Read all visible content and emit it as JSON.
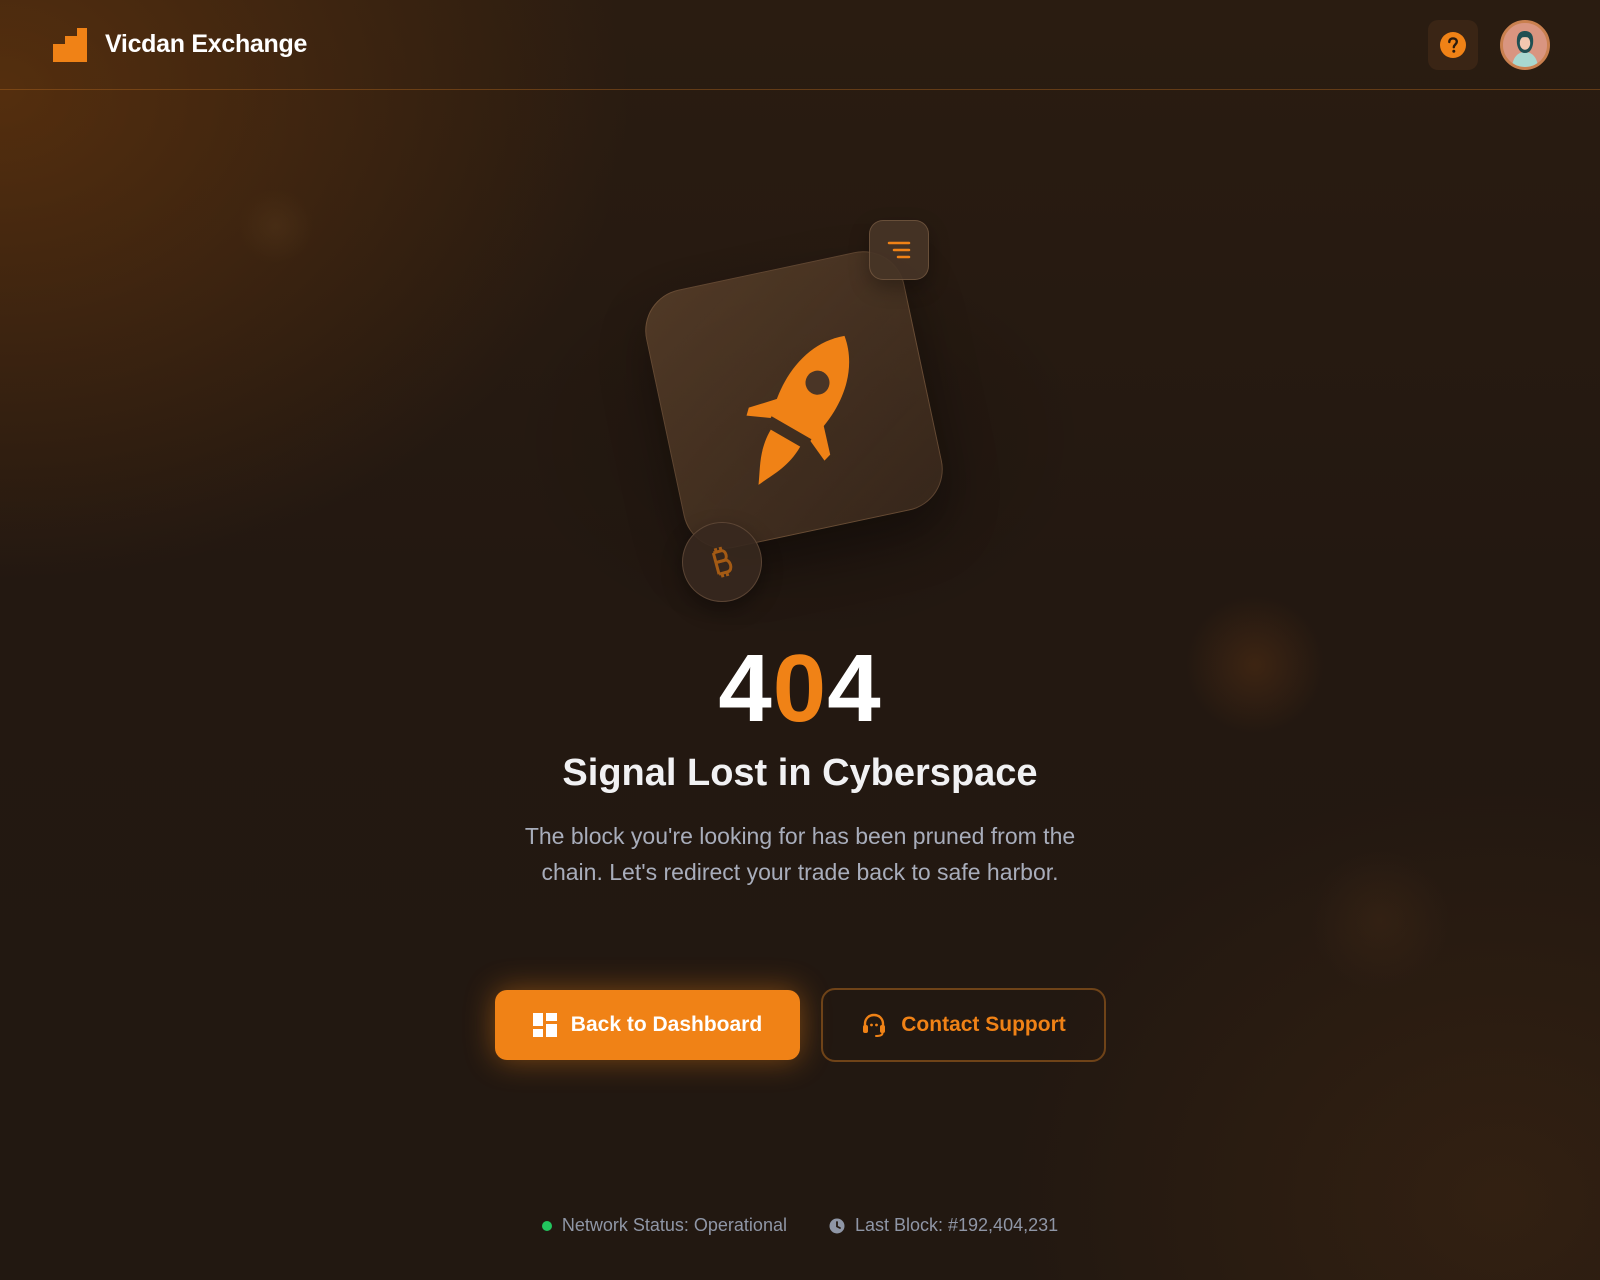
{
  "header": {
    "brand_name": "Vicdan Exchange",
    "logo_icon": "stair-blocks-logo",
    "help_icon": "question-circle-icon",
    "avatar_icon": "user-avatar"
  },
  "hero": {
    "error_code_parts": [
      "4",
      "0",
      "4"
    ],
    "title": "Signal Lost in Cyberspace",
    "description": "The block you're looking for has been pruned from the chain. Let's redirect your trade back to safe harbor.",
    "illustration_icons": [
      "rocket-icon",
      "menu-lines-icon",
      "bitcoin-icon"
    ]
  },
  "actions": {
    "primary_label": "Back to Dashboard",
    "primary_icon": "dashboard-grid-icon",
    "secondary_label": "Contact Support",
    "secondary_icon": "headset-icon"
  },
  "footer": {
    "network_status": "Network Status: Operational",
    "last_block": "Last Block: #192,404,231"
  },
  "colors": {
    "accent": "#f08216",
    "background": "#221811",
    "status_ok": "#22c55e",
    "muted_text": "#a8adbb"
  }
}
